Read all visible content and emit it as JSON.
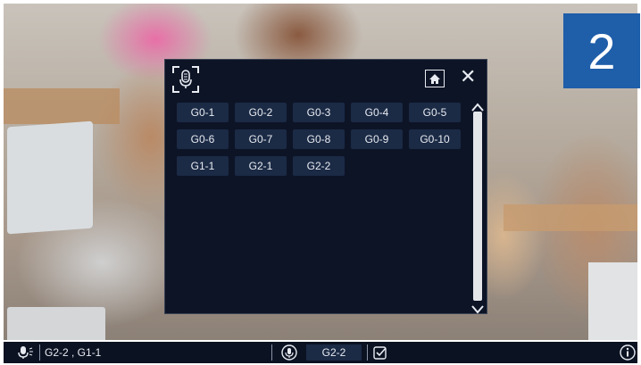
{
  "badge": {
    "number": "2"
  },
  "panel": {
    "mic_icon": "microphone-icon",
    "home_icon": "home-icon",
    "close_icon": "close-icon",
    "close_glyph": "✕",
    "groups": [
      "G0-1",
      "G0-2",
      "G0-3",
      "G0-4",
      "G0-5",
      "G0-6",
      "G0-7",
      "G0-8",
      "G0-9",
      "G0-10",
      "G1-1",
      "G2-1",
      "G2-2"
    ],
    "scroll_up_icon": "chevron-up-icon",
    "scroll_down_icon": "chevron-down-icon"
  },
  "bottom_bar": {
    "mic_icon": "microphone-speaking-icon",
    "active_groups": "G2-2 , G1-1",
    "mic_circle_icon": "microphone-circle-icon",
    "current_group": "G2-2",
    "checkbox_icon": "checkbox-icon",
    "info_icon": "info-icon"
  },
  "colors": {
    "panel_bg": "#0d1426",
    "button_bg": "#1b2a45",
    "badge_bg": "#1f5ea9",
    "text": "#e8ebf1"
  }
}
